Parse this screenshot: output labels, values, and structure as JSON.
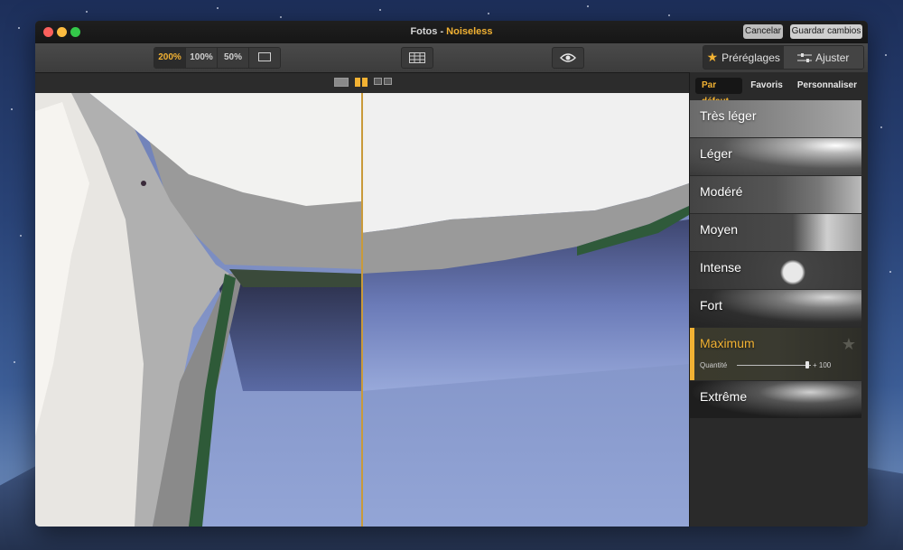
{
  "window": {
    "title_app": "Fotos",
    "title_separator": " - ",
    "title_plugin": "Noiseless",
    "cancel_label": "Cancelar",
    "save_label": "Guardar cambios"
  },
  "toolbar": {
    "zoom_options": [
      "200%",
      "100%",
      "50%"
    ],
    "active_zoom": "200%",
    "presets_tab_label": "Préréglages",
    "adjust_tab_label": "Ajuster"
  },
  "sidebar": {
    "tabs": [
      "Par défaut",
      "Favoris",
      "Personnaliser"
    ],
    "active_tab": "Par défaut",
    "presets": [
      {
        "label": "Très léger"
      },
      {
        "label": "Léger"
      },
      {
        "label": "Modéré"
      },
      {
        "label": "Moyen"
      },
      {
        "label": "Intense"
      },
      {
        "label": "Fort"
      },
      {
        "label": "Maximum"
      },
      {
        "label": "Extrême"
      }
    ],
    "active_preset": "Maximum",
    "quantity_label": "Quantité",
    "quantity_value_text": "+ 100",
    "quantity_value": 100
  },
  "colors": {
    "accent": "#f2b233",
    "window_bg": "#2b2b2b"
  }
}
